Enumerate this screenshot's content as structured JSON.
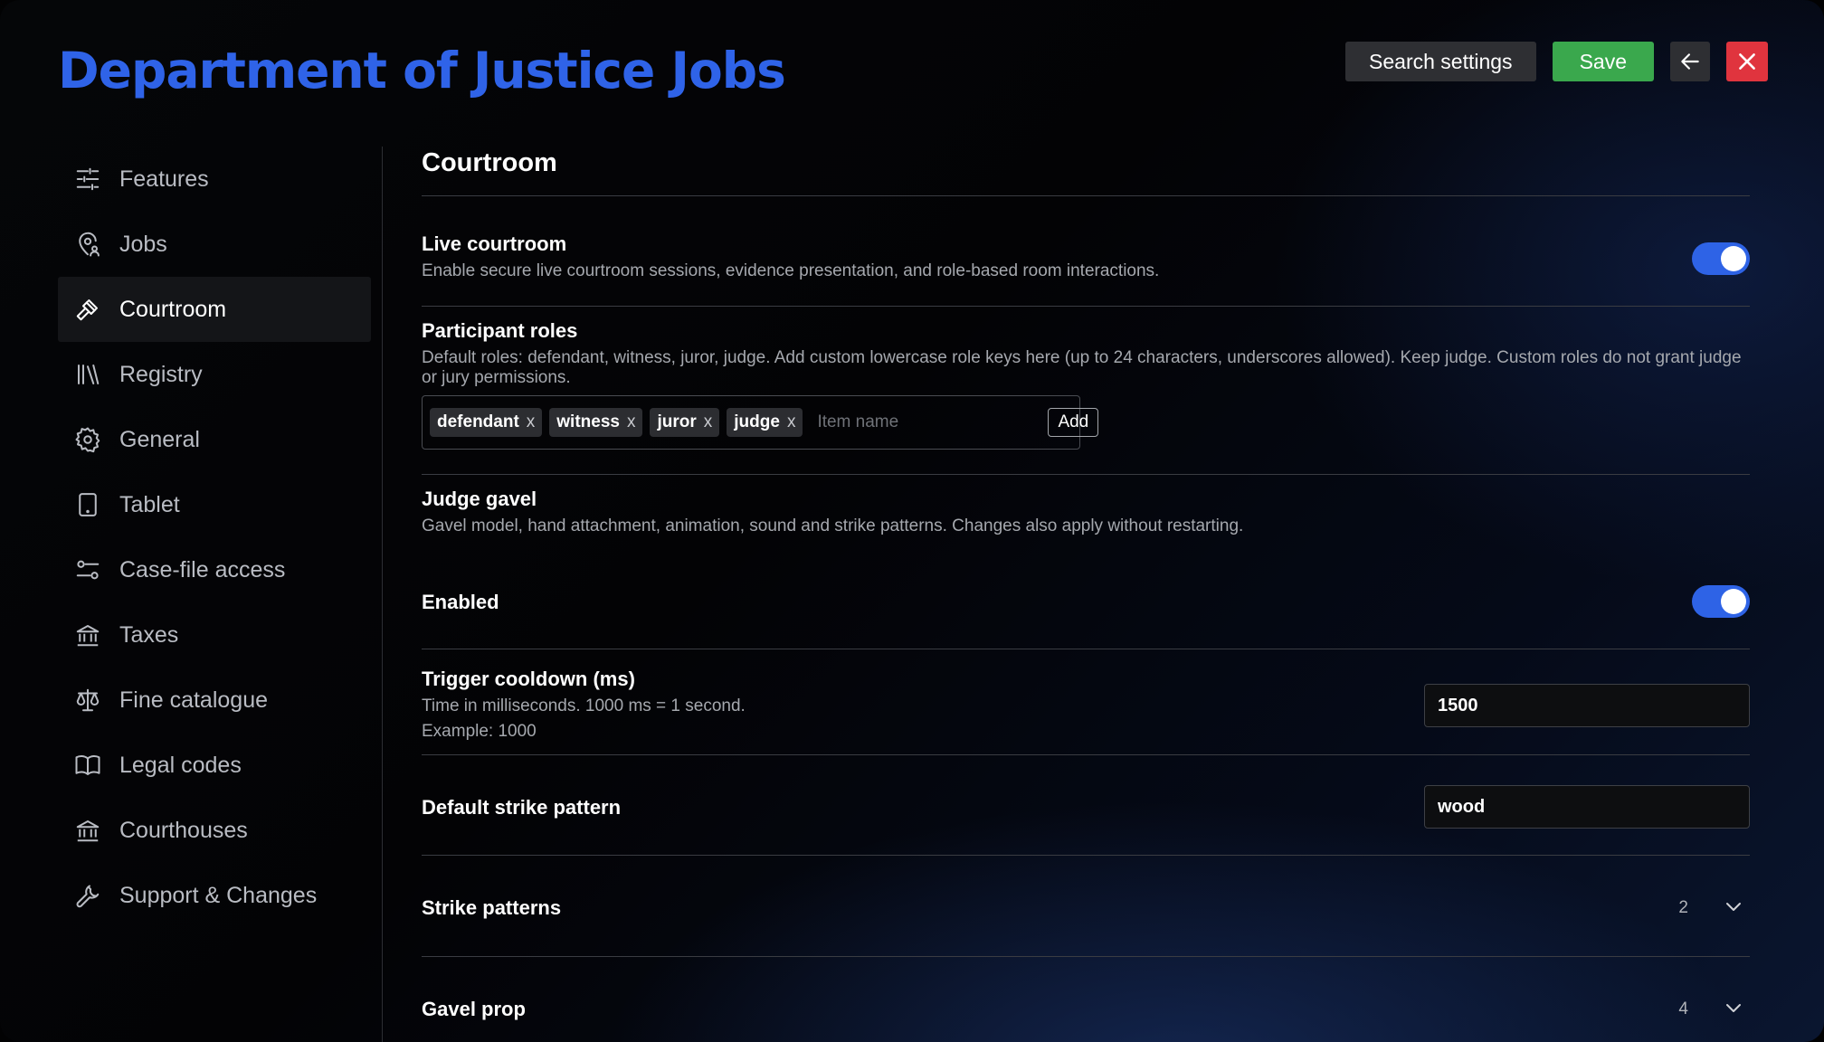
{
  "app": {
    "title": "Department of Justice Jobs"
  },
  "top_actions": {
    "search_label": "Search settings",
    "save_label": "Save"
  },
  "sidebar": {
    "items": [
      {
        "label": "Features",
        "icon": "sliders-icon"
      },
      {
        "label": "Jobs",
        "icon": "map-pin-user-icon"
      },
      {
        "label": "Courtroom",
        "icon": "gavel-icon",
        "active": true
      },
      {
        "label": "Registry",
        "icon": "library-icon"
      },
      {
        "label": "General",
        "icon": "gear-icon"
      },
      {
        "label": "Tablet",
        "icon": "tablet-icon"
      },
      {
        "label": "Case-file access",
        "icon": "settings-toggle-icon"
      },
      {
        "label": "Taxes",
        "icon": "bank-icon"
      },
      {
        "label": "Fine catalogue",
        "icon": "scale-icon"
      },
      {
        "label": "Legal codes",
        "icon": "book-icon"
      },
      {
        "label": "Courthouses",
        "icon": "bank-icon"
      },
      {
        "label": "Support & Changes",
        "icon": "wrench-icon"
      }
    ]
  },
  "main": {
    "section_title": "Courtroom",
    "live": {
      "title": "Live courtroom",
      "desc": "Enable secure live courtroom sessions, evidence presentation, and role-based room interactions.",
      "enabled": true
    },
    "roles": {
      "title": "Participant roles",
      "desc": "Default roles: defendant, witness, juror, judge. Add custom lowercase role keys here (up to 24 characters, underscores allowed). Keep judge. Custom roles do not grant judge or jury permissions.",
      "tags": [
        "defendant",
        "witness",
        "juror",
        "judge"
      ],
      "tag_remove": "x",
      "placeholder": "Item name",
      "add_label": "Add"
    },
    "gavel": {
      "title": "Judge gavel",
      "desc": "Gavel model, hand attachment, animation, sound and strike patterns. Changes also apply without restarting."
    },
    "enabled": {
      "title": "Enabled",
      "enabled": true
    },
    "cooldown": {
      "title": "Trigger cooldown (ms)",
      "desc": "Time in milliseconds. 1000 ms = 1 second.",
      "example": "Example: 1000",
      "value": "1500"
    },
    "strike": {
      "title": "Default strike pattern",
      "value": "wood"
    },
    "strike_patterns": {
      "title": "Strike patterns",
      "count": "2"
    },
    "gavel_prop": {
      "title": "Gavel prop",
      "count": "4"
    }
  },
  "colors": {
    "accent": "#2f63e8",
    "save": "#3aa84d",
    "close": "#e0343e"
  }
}
